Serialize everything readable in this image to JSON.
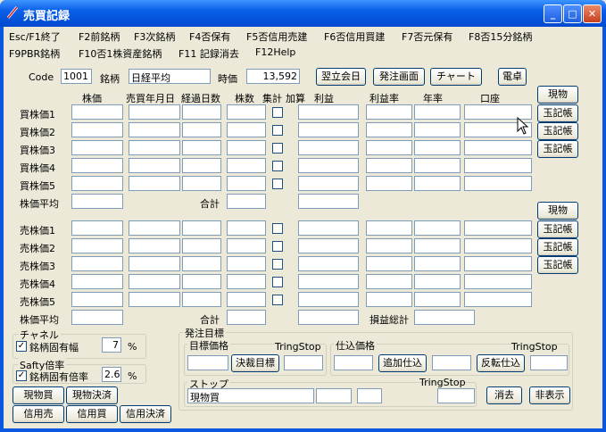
{
  "window": {
    "title": "売買記録",
    "min": "_",
    "max": "□",
    "close": "✕"
  },
  "menu": {
    "row1": [
      "Esc/F1終了",
      "F2前銘柄",
      "F3次銘柄",
      "F4否保有",
      "F5否信用売建",
      "F6否信用買建",
      "F7否元保有",
      "F8否15分銘柄"
    ],
    "row2": [
      "F9PBR銘柄",
      "F10否1株資産銘柄",
      "F11 記録消去",
      "F12Help"
    ]
  },
  "topbar": {
    "code_label": "Code",
    "code_value": "1001",
    "name_label": "銘柄",
    "name_value": "日経平均",
    "price_label": "時価",
    "price_value": "13,592",
    "btn_next_day": "翌立会日",
    "btn_order": "発注画面",
    "btn_chart": "チャート",
    "btn_calc": "電卓"
  },
  "columns": [
    "株価",
    "売買年月日",
    "経過日数",
    "株数",
    "集計",
    "加算",
    "利益",
    "利益率",
    "年率",
    "口座"
  ],
  "buy": {
    "rows": [
      "買株価1",
      "買株価2",
      "買株価3",
      "買株価4",
      "買株価5"
    ],
    "avg_label": "株価平均",
    "sum_label": "合計",
    "side_btn": "現物",
    "ledger_btn": "玉記帳"
  },
  "sell": {
    "rows": [
      "売株価1",
      "売株価2",
      "売株価3",
      "売株価4",
      "売株価5"
    ],
    "avg_label": "株価平均",
    "sum_label": "合計",
    "pl_total_label": "損益総計",
    "side_btn": "現物",
    "ledger_btn": "玉記帳"
  },
  "channel": {
    "title": "チャネル",
    "check_label": "銘柄固有幅",
    "value": "7",
    "unit": "%",
    "checked": true
  },
  "safety": {
    "title": "Safty倍率",
    "check_label": "銘柄固有倍率",
    "value": "2.6",
    "unit": "%",
    "checked": true
  },
  "bottom_buttons": [
    "現物買",
    "現物決済",
    "信用売",
    "信用買",
    "信用決済"
  ],
  "order": {
    "title": "発注目標",
    "target": {
      "title": "目標価格",
      "tring": "TringStop",
      "btn": "決裁目標"
    },
    "entry": {
      "title": "仕込価格",
      "tring": "TringStop",
      "btn_add": "追加仕込",
      "btn_rev": "反転仕込"
    },
    "stop": {
      "title": "ストップ",
      "tring": "TringStop",
      "field": "現物買"
    },
    "btn_clear": "消去",
    "btn_hide": "非表示"
  },
  "colors": {
    "titlebar": "#0a5fe8",
    "face": "#ece9d8",
    "border": "#7f9db9"
  }
}
